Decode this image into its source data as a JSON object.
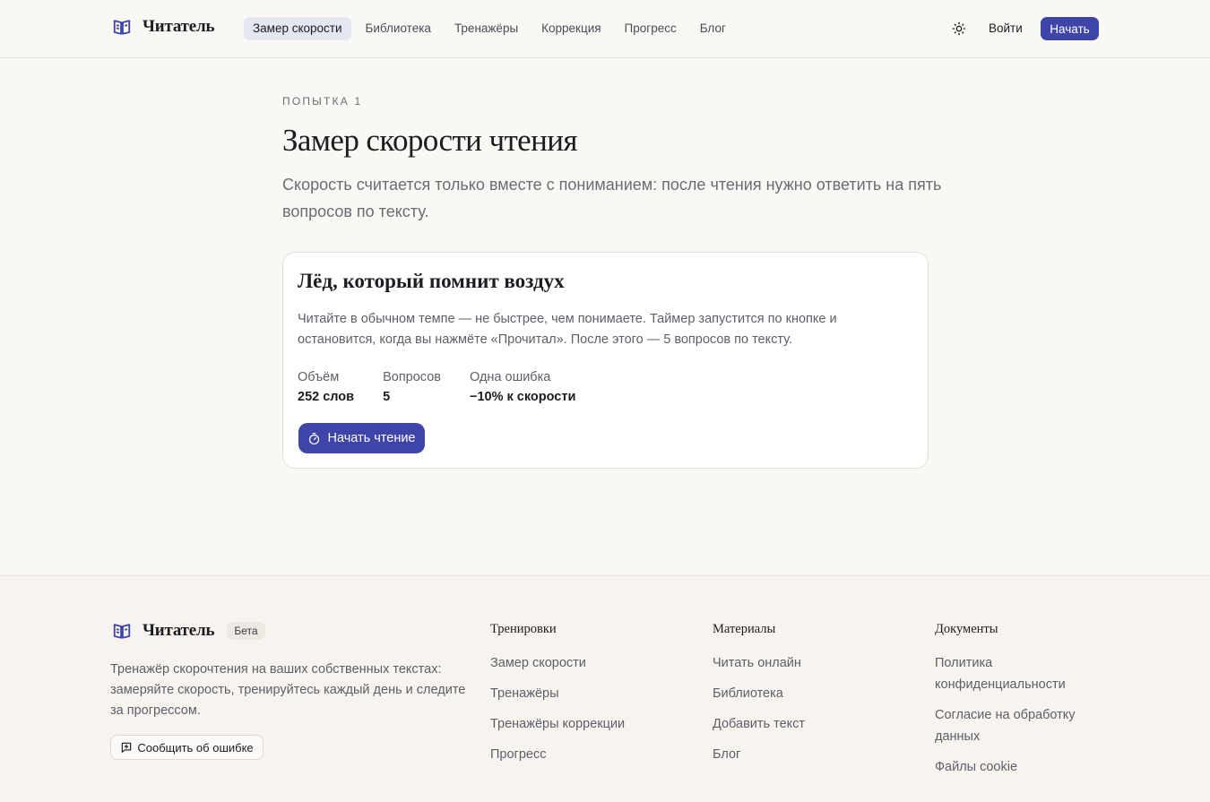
{
  "header": {
    "logo_text": "Читатель",
    "nav": [
      {
        "label": "Замер скорости",
        "active": true
      },
      {
        "label": "Библиотека",
        "active": false
      },
      {
        "label": "Тренажёры",
        "active": false
      },
      {
        "label": "Коррекция",
        "active": false
      },
      {
        "label": "Прогресс",
        "active": false
      },
      {
        "label": "Блог",
        "active": false
      }
    ],
    "theme_icon": "sun-icon",
    "login_label": "Войти",
    "start_label": "Начать"
  },
  "main": {
    "eyebrow": "ПОПЫТКА 1",
    "title": "Замер скорости чтения",
    "lead": "Скорость считается только вместе с пониманием: после чтения нужно ответить на пять вопросов по тексту."
  },
  "card": {
    "title": "Лёд, который помнит воздух",
    "text": "Читайте в обычном темпе — не быстрее, чем понимаете. Таймер запустится по кнопке и остановится, когда вы нажмёте «Прочитал». После этого — 5 вопросов по тексту.",
    "stats": [
      {
        "label": "Объём",
        "value": "252 слов"
      },
      {
        "label": "Вопросов",
        "value": "5"
      },
      {
        "label": "Одна ошибка",
        "value": "−10% к скорости"
      }
    ],
    "button_label": "Начать чтение"
  },
  "footer": {
    "logo_text": "Читатель",
    "badge": "Бета",
    "description": "Тренажёр скорочтения на ваших собственных текстах: замеряйте скорость, тренируйтесь каждый день и следите за прогрессом.",
    "report_label": "Сообщить об ошибке",
    "columns": [
      {
        "title": "Тренировки",
        "links": [
          "Замер скорости",
          "Тренажёры",
          "Тренажёры коррекции",
          "Прогресс"
        ]
      },
      {
        "title": "Материалы",
        "links": [
          "Читать онлайн",
          "Библиотека",
          "Добавить текст",
          "Блог"
        ]
      },
      {
        "title": "Документы",
        "links": [
          "Политика конфиденциальности",
          "Согласие на обработку данных",
          "Файлы cookie"
        ]
      }
    ]
  },
  "colors": {
    "accent": "#3e44a8",
    "background": "#faf8f5",
    "nav_active_bg": "#e4e6f1"
  }
}
